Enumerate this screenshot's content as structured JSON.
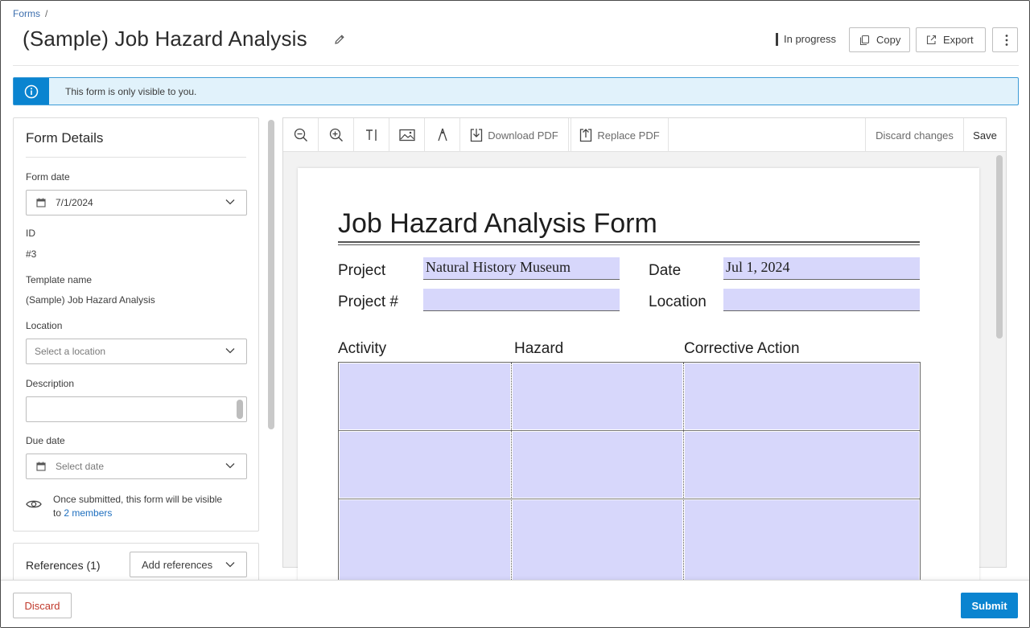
{
  "breadcrumb": {
    "root": "Forms",
    "separator": "/"
  },
  "header": {
    "title": "(Sample) Job Hazard Analysis",
    "status": "In progress",
    "copy_label": "Copy",
    "export_label": "Export"
  },
  "banner": {
    "text": "This form is only visible to you."
  },
  "details": {
    "heading": "Form Details",
    "form_date_label": "Form date",
    "form_date_value": "7/1/2024",
    "id_label": "ID",
    "id_value": "#3",
    "template_label": "Template name",
    "template_value": "(Sample) Job Hazard Analysis",
    "location_label": "Location",
    "location_placeholder": "Select a location",
    "description_label": "Description",
    "due_date_label": "Due date",
    "due_date_placeholder": "Select date",
    "visibility_text": "Once submitted, this form will be visible to",
    "visibility_link": "2 members"
  },
  "references": {
    "label": "References (1)",
    "add_label": "Add references"
  },
  "toolbar": {
    "download_label": "Download PDF",
    "replace_label": "Replace PDF",
    "discard_label": "Discard changes",
    "save_label": "Save"
  },
  "pdf": {
    "title": "Job Hazard Analysis Form",
    "project_label": "Project",
    "project_value": "Natural History Museum",
    "date_label": "Date",
    "date_value": "Jul 1, 2024",
    "project_num_label": "Project #",
    "project_num_value": "",
    "location_label": "Location",
    "location_value": "",
    "columns": [
      "Activity",
      "Hazard",
      "Corrective Action"
    ]
  },
  "footer": {
    "discard_label": "Discard",
    "submit_label": "Submit"
  },
  "colors": {
    "accent": "#0a84d0",
    "banner_bg": "#e1f2fb",
    "field_fill": "#d7d7fb",
    "discard_text": "#c0392b"
  }
}
